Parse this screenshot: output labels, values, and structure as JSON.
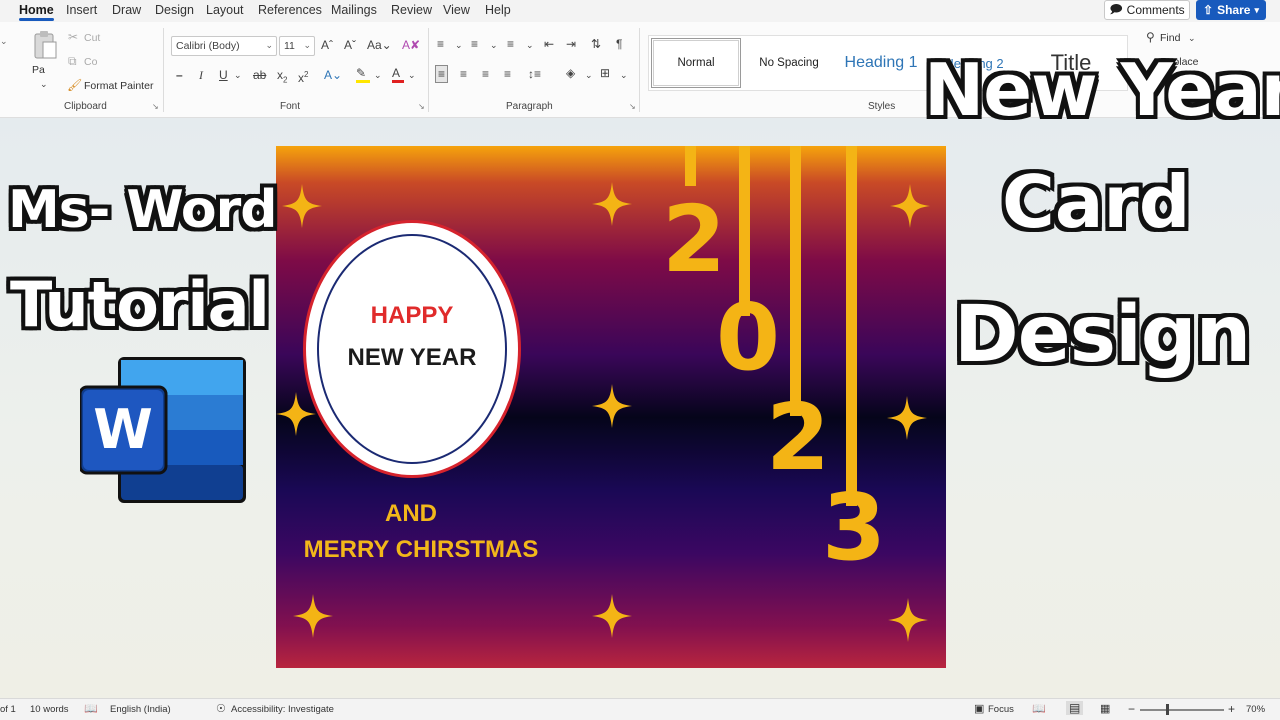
{
  "tabs": [
    "Home",
    "Insert",
    "Draw",
    "Design",
    "Layout",
    "References",
    "Mailings",
    "Review",
    "View",
    "Help"
  ],
  "active_tab": "Home",
  "header_buttons": {
    "comments": "Comments",
    "share": "Share"
  },
  "clipboard": {
    "paste_label": "Pa",
    "cut": "Cut",
    "copy": "Co",
    "format_painter": "Format Painter",
    "group_label": "Clipboard"
  },
  "font": {
    "family": "Calibri (Body)",
    "size": "11",
    "group_label": "Font"
  },
  "paragraph": {
    "group_label": "Paragraph"
  },
  "styles": {
    "items": [
      "Normal",
      "No Spacing",
      "Heading 1",
      "Heading 2",
      "Title"
    ],
    "group_label": "Styles"
  },
  "editing": {
    "find": "Find",
    "replace": "Replace"
  },
  "card": {
    "happy": "HAPPY",
    "new_year": "NEW YEAR",
    "and": "AND",
    "merry_christmas": "MERRY CHIRSTMAS",
    "year_digits": [
      "2",
      "0",
      "2",
      "3"
    ]
  },
  "overlay": {
    "ms_word": "Ms- Word",
    "tutorial": "Tutorial",
    "new_year": "New Year",
    "card": "Card",
    "design": "Design",
    "logo_letter": "W"
  },
  "status": {
    "page": "of 1",
    "words": "10 words",
    "language": "English (India)",
    "accessibility": "Accessibility: Investigate",
    "focus": "Focus",
    "zoom": "70%"
  },
  "colors": {
    "accent": "#185abd",
    "gold": "#f4b415",
    "red": "#d6232d",
    "navy": "#1b2a73"
  }
}
